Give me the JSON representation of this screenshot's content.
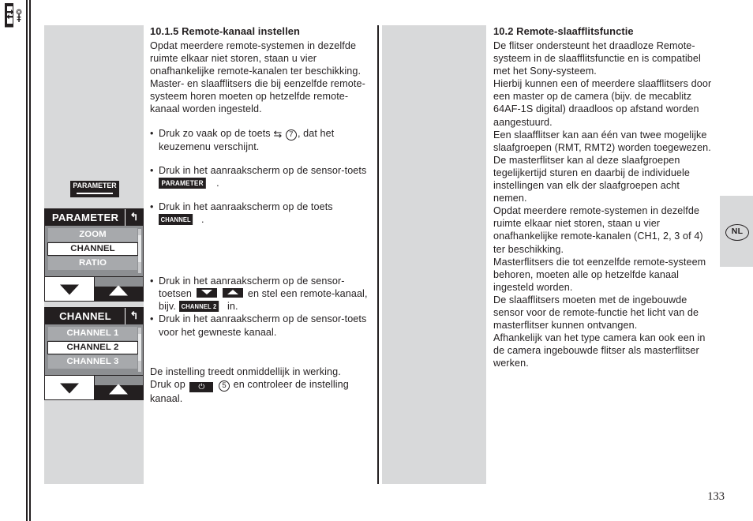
{
  "page": {
    "number": "133",
    "language_tab": "NL"
  },
  "left_column": {
    "heading": "10.1.5 Remote-kanaal instellen",
    "intro": "Opdat meerdere remote-systemen in dezelfde ruimte elkaar niet storen, staan u vier onafhankelijke remote-kanalen ter beschikking. Master- en slaafflitsers die bij eenzelfde remote-systeem horen moeten op hetzelfde remote-kanaal worden ingesteld.",
    "bullets": {
      "b1_pre": "Druk zo vaak op de toets",
      "b1_glyph": "⇆",
      "b1_circled": "7",
      "b1_post": ", dat het keuzemenu verschijnt.",
      "b2_pre": "Druk in het  aanraakscherm op de sensor-toets",
      "b2_badge": "PARAMETER",
      "b2_post": ".",
      "b3_pre": "Druk in het aanraakscherm op de toets",
      "b3_badge": "CHANNEL",
      "b3_post": ".",
      "b4_pre": "Druk in het aanraakscherm op de sensor-toetsen",
      "b4_arrow_down": "down-arrow",
      "b4_arrow_up": "up-arrow",
      "b4_mid": "en stel een remote-kanaal,  bijv.",
      "b4_badge": "CHANNEL 2",
      "b4_post": "in.",
      "b5": "Druk in het aanraakscherm op de sensor-toets voor het gewneste kanaal."
    },
    "closing": {
      "line1": "De instelling treedt onmiddellijk in werking.",
      "line2_pre": "Druk op",
      "line2_power": "⏻",
      "line2_circled": "5",
      "line2_post": "en controleer de instelling kanaal."
    }
  },
  "right_column": {
    "heading": "10.2 Remote-slaafflitsfunctie",
    "paragraphs": [
      "De flitser ondersteunt het draadloze Remote-systeem in de slaafflitsfunctie en is compatibel met het Sony-systeem.",
      " Hierbij kunnen een of meerdere slaafflitsers door een master op de camera (bijv. de mecablitz 64AF-1S digital) draadloos op afstand worden aangestuurd.",
      "Een slaafflitser kan aan één van twee mogelijke slaafgroepen (RMT, RMT2) worden toegewezen. De masterflitser kan al deze slaafgroepen tegelijkertijd sturen en daarbij de individuele instellingen van elk der slaafgroepen acht nemen.",
      "Opdat meerdere remote-systemen in dezelfde ruimte elkaar niet storen, staan u vier onafhankelijke remote-kanalen (CH1, 2, 3 of 4) ter beschikking.",
      "Masterflitsers die tot eenzelfde remote-systeem behoren, moeten alle op hetzelfde kanaal ingesteld worden.",
      "De slaafflitsers moeten met de ingebouwde sensor voor de remote-functie het licht van de masterflitser kunnen ontvangen.",
      "Afhankelijk van het type camera kan ook een in de camera ingebouwde flitser als masterflitser werken."
    ]
  },
  "graphics": {
    "parameter_key_label": "PARAMETER",
    "menu_parameter": {
      "title": "PARAMETER",
      "back_glyph": "↰",
      "rows": [
        {
          "label": "ZOOM",
          "selected": false
        },
        {
          "label": "CHANNEL",
          "selected": true
        },
        {
          "label": "RATIO",
          "selected": false
        }
      ]
    },
    "menu_channel": {
      "title": "CHANNEL",
      "back_glyph": "↰",
      "rows": [
        {
          "label": "CHANNEL 1",
          "selected": false
        },
        {
          "label": "CHANNEL 2",
          "selected": true
        },
        {
          "label": "CHANNEL 3",
          "selected": false
        }
      ]
    }
  },
  "colors": {
    "gray_panel": "#d8d9da",
    "ink": "#231f20",
    "menu_bg": "#8d8f92",
    "menu_row": "#a7a9ac"
  }
}
